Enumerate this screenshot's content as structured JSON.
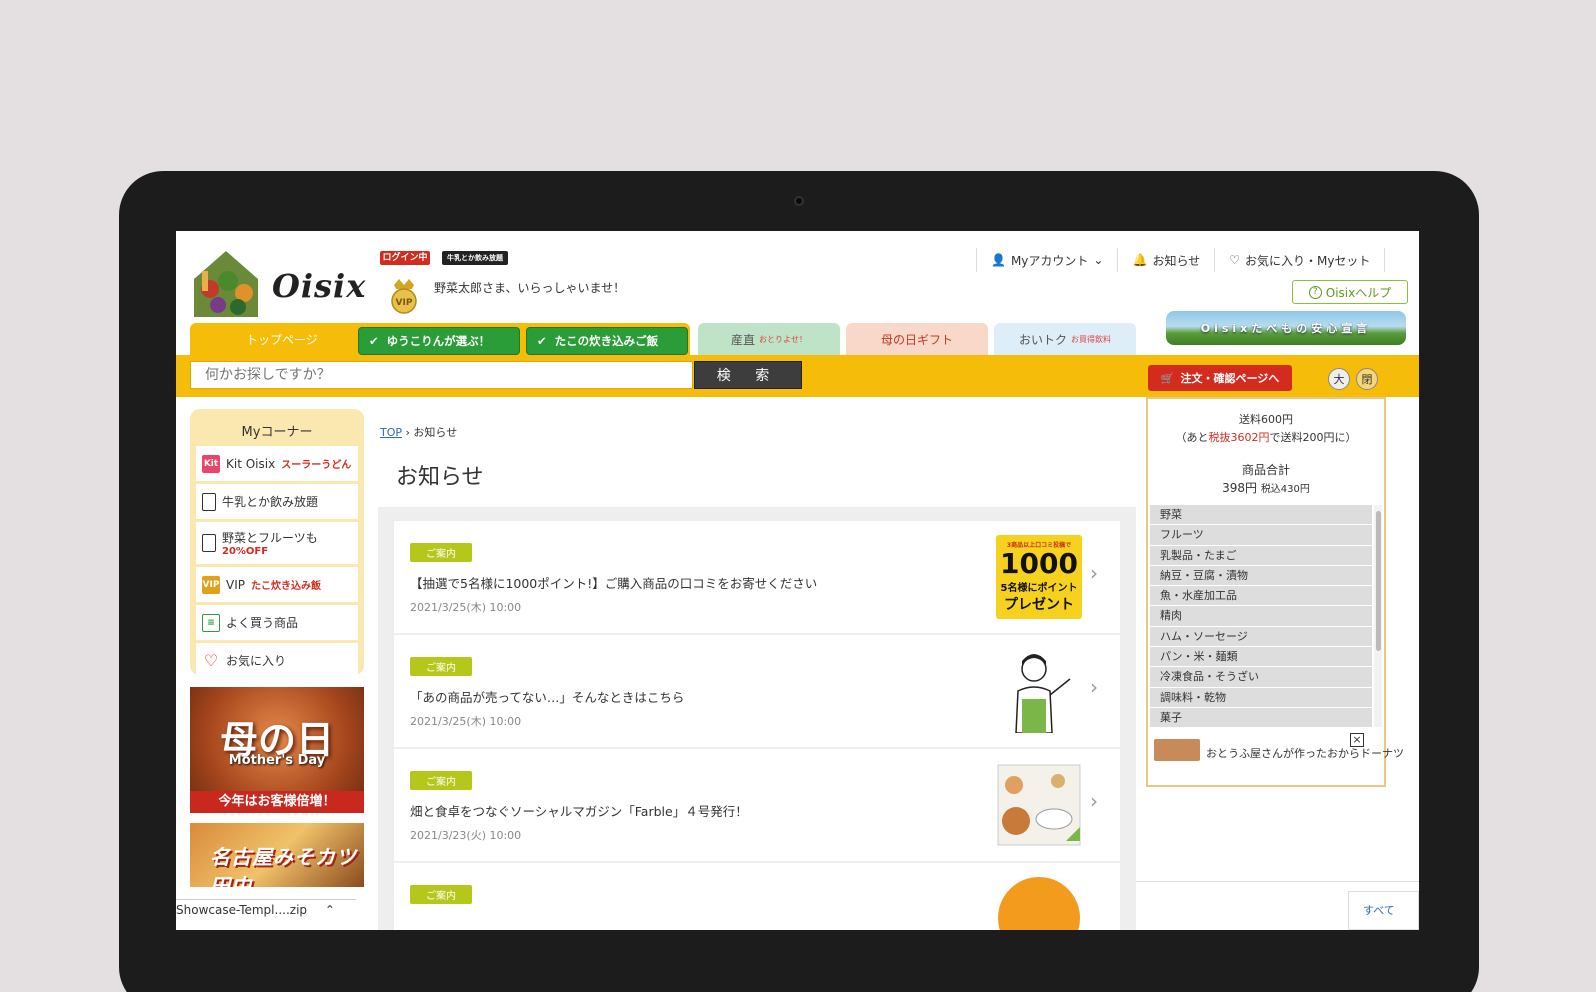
{
  "header": {
    "logo_text": "Oisix",
    "badge_login": "ログイン中",
    "badge_milk": "牛乳とか飲み放題",
    "vip_badge": "VIP",
    "greeting": "野菜太郎さま、いらっしゃいませ！",
    "top_nav": [
      {
        "icon": "person-icon",
        "label": "Myアカウント"
      },
      {
        "icon": "bell-icon",
        "label": "お知らせ"
      },
      {
        "icon": "heart-icon",
        "label": "お気に入り・Myセット"
      }
    ],
    "help_label": "Oisixヘルプ"
  },
  "tabs": {
    "top": "トップページ",
    "green1": "ゆうこりんが選ぶ！",
    "green2": "たこの炊き込みご飯",
    "sanchoku": "産直",
    "sanchoku_small": "おとりよせ！",
    "haha": "母の日ギフト",
    "otoku": "おいトク",
    "otoku_small": "お買得飲料",
    "safe_banner": "Oisixたべもの安心宣言"
  },
  "search": {
    "placeholder": "何かお探しですか？",
    "button": "検 索",
    "cart_button": "注文・確認ページへ",
    "size_large": "大",
    "close": "閉"
  },
  "my_corner": {
    "title": "Myコーナー",
    "items": [
      {
        "icon": "Kit",
        "label": "Kit Oisix",
        "sub": "スーラーうどん"
      },
      {
        "label": "牛乳とか飲み放題"
      },
      {
        "label": "野菜とフルーツも",
        "sub": "20%OFF"
      },
      {
        "icon": "VIP",
        "label": "VIP",
        "sub": "たこ炊き込み飯"
      },
      {
        "label": "よく買う商品"
      },
      {
        "label": "お気に入り"
      }
    ]
  },
  "promo": {
    "mothers_title": "母の日",
    "mothers_en": "Mother's Day",
    "mothers_band": "今年はお客様倍増！",
    "katsu": "名古屋みそカツ田中"
  },
  "download": "Showcase-Templ....zip",
  "breadcrumb": {
    "top": "TOP",
    "current": "お知らせ"
  },
  "page_title": "お知らせ",
  "news": [
    {
      "badge": "ご案内",
      "title": "【抽選で5名様に1000ポイント!】ご購入商品の口コミをお寄せください",
      "date": "2021/3/25(木) 10:00",
      "thumb_big": "1000",
      "thumb_small": "5名様にポイント",
      "thumb_line": "プレゼント",
      "thumb_top": "3商品以上口コミ投稿で"
    },
    {
      "badge": "ご案内",
      "title": "「あの商品が売ってない…」そんなときはこちら",
      "date": "2021/3/25(木) 10:00"
    },
    {
      "badge": "ご案内",
      "title": "畑と食卓をつなぐソーシャルマガジン「Farble」４号発行！",
      "date": "2021/3/23(火) 10:00"
    },
    {
      "badge": "ご案内",
      "title": "",
      "date": ""
    }
  ],
  "cart": {
    "shipping": "送料600円",
    "shipping_note_pre": "（あと",
    "shipping_note_red": "税抜3602円",
    "shipping_note_post": "で送料200円に）",
    "total_label": "商品合計",
    "total_value": "398円",
    "total_tax": "税込430円",
    "categories": [
      "野菜",
      "フルーツ",
      "乳製品・たまご",
      "納豆・豆腐・漬物",
      "魚・水産加工品",
      "精肉",
      "ハム・ソーセージ",
      "パン・米・麺類",
      "冷凍食品・そうざい",
      "調味料・乾物",
      "菓子"
    ],
    "popup_text": "おとうふ屋さんが作ったおからドーナツ"
  },
  "all_link": "すべて",
  "colors": {
    "brand_yellow": "#f5bd0a",
    "green": "#2a9d38",
    "red": "#d42b1f",
    "badge": "#b5c71a"
  }
}
